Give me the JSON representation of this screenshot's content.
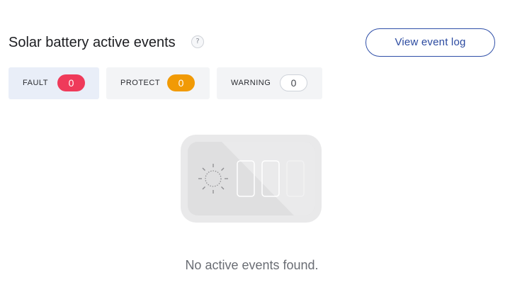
{
  "header": {
    "title": "Solar battery active events",
    "help_glyph": "?",
    "view_log_label": "View event log"
  },
  "filters": [
    {
      "label": "FAULT",
      "count": "0",
      "color": "#ef3a5a"
    },
    {
      "label": "PROTECT",
      "count": "0",
      "color": "#f19a05"
    },
    {
      "label": "WARNING",
      "count": "0",
      "color": "#ffffff"
    }
  ],
  "empty_state": {
    "icon": "solar-battery-illustration",
    "message": "No active events found."
  },
  "colors": {
    "accent": "#2b4aa0",
    "fault": "#ef3a5a",
    "protect": "#f19a05"
  }
}
